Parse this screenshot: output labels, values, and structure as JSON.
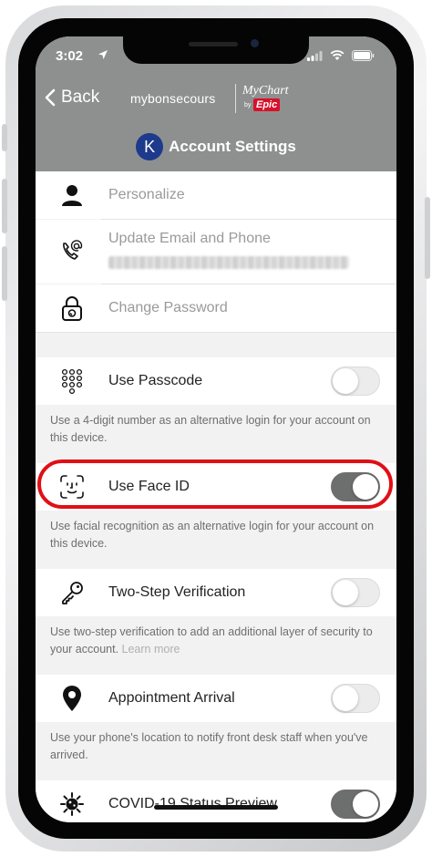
{
  "status_bar": {
    "time": "3:02"
  },
  "header": {
    "back_label": "Back",
    "brand": "mybonsecours",
    "mychart_text": "MyChart",
    "mychart_by": "by",
    "mychart_epic": "Epic",
    "avatar_letter": "K",
    "title": "Account Settings"
  },
  "rows": {
    "personalize": {
      "label": "Personalize",
      "icon": "person-icon"
    },
    "email_phone": {
      "label": "Update Email and Phone",
      "icon": "phone-at-icon"
    },
    "password": {
      "label": "Change Password",
      "icon": "lock-icon"
    },
    "passcode": {
      "label": "Use Passcode",
      "icon": "keypad-icon",
      "enabled": false,
      "description": "Use a 4-digit number as an alternative login for your account on this device."
    },
    "face_id": {
      "label": "Use Face ID",
      "icon": "face-id-icon",
      "enabled": true,
      "description": "Use facial recognition as an alternative login for your account on this device."
    },
    "two_step": {
      "label": "Two-Step Verification",
      "icon": "key-icon",
      "enabled": false,
      "description": "Use two-step verification to add an additional layer of security to your account.",
      "link": "Learn more"
    },
    "arrival": {
      "label": "Appointment Arrival",
      "icon": "location-pin-icon",
      "enabled": false,
      "description": "Use your phone's location to notify front desk staff when you've arrived."
    },
    "covid": {
      "label": "COVID-19 Status Preview",
      "icon": "virus-icon",
      "enabled": true
    }
  },
  "colors": {
    "header": "#8e9090",
    "highlight": "#e10f16",
    "toggle_on": "#6d6f6f",
    "avatar": "#1d3a8c",
    "epic": "#d8102a"
  }
}
